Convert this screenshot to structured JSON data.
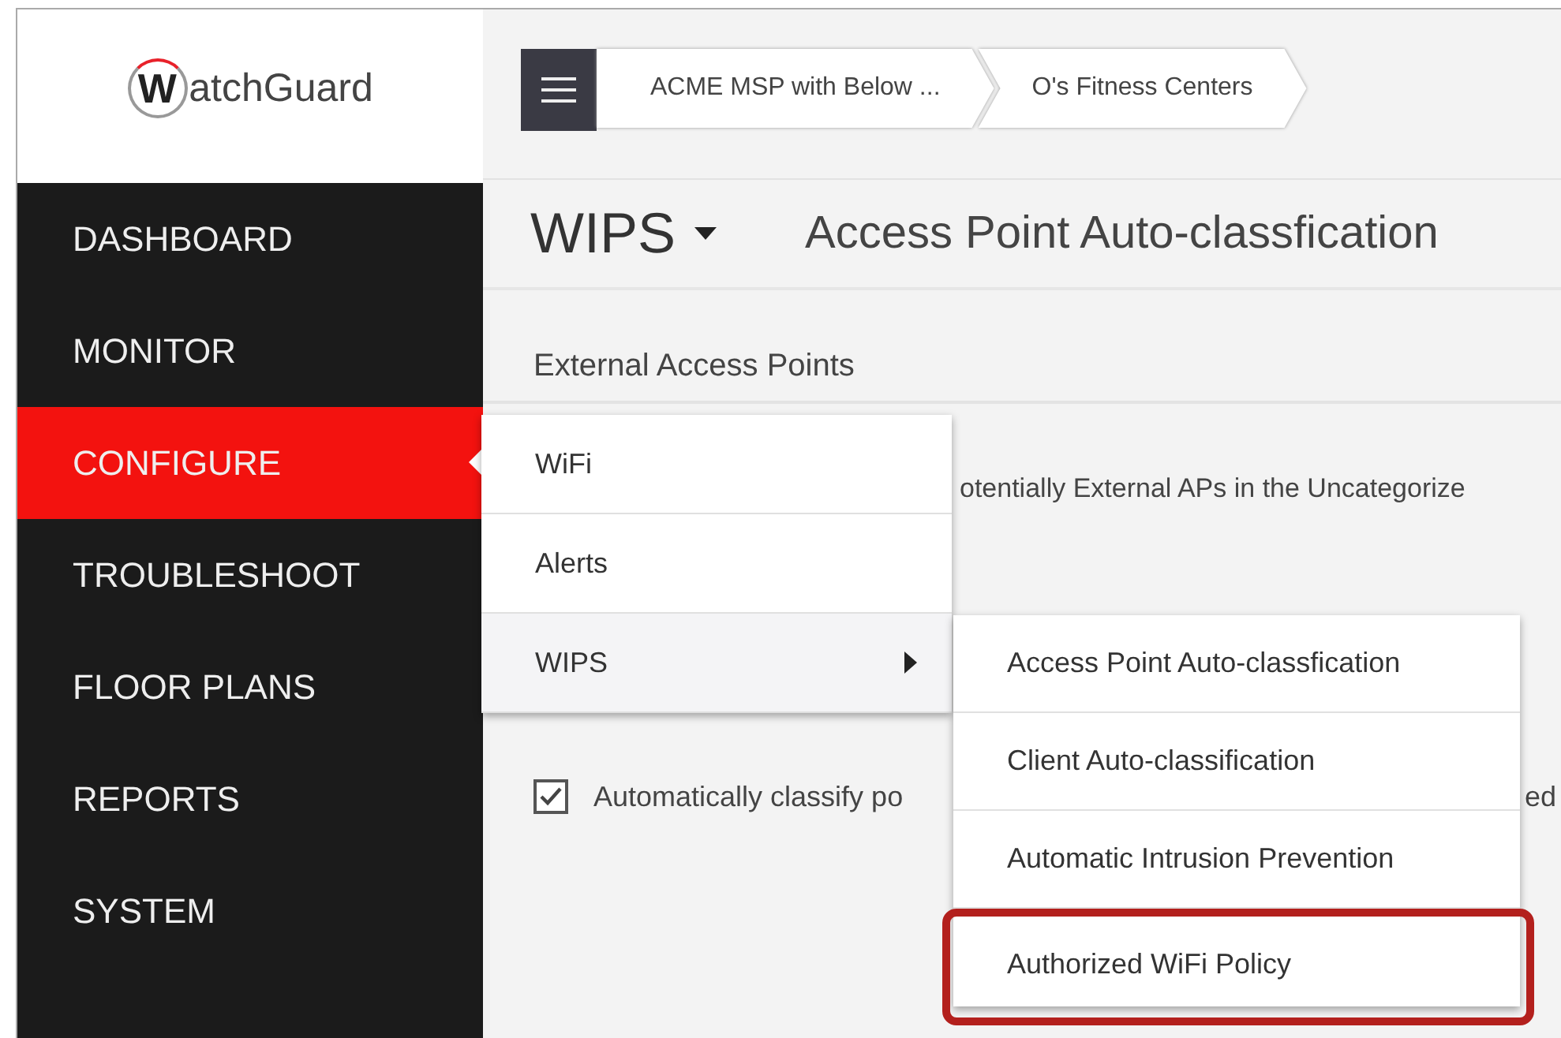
{
  "logo": {
    "initial": "W",
    "rest": "atchGuard"
  },
  "nav": [
    {
      "label": "DASHBOARD",
      "selected": false
    },
    {
      "label": "MONITOR",
      "selected": false
    },
    {
      "label": "CONFIGURE",
      "selected": true
    },
    {
      "label": "TROUBLESHOOT",
      "selected": false
    },
    {
      "label": "FLOOR PLANS",
      "selected": false
    },
    {
      "label": "REPORTS",
      "selected": false
    },
    {
      "label": "SYSTEM",
      "selected": false
    }
  ],
  "breadcrumbs": [
    "ACME MSP with Below ...",
    "O's Fitness Centers"
  ],
  "page_title": "WIPS",
  "page_subtitle": "Access Point Auto-classfication",
  "section_title": "External Access Points",
  "description_fragment": "otentially External APs in the Uncategorize",
  "auto_classify": {
    "checked": true,
    "label_fragment": "Automatically classify po",
    "trailing_fragment": "ed"
  },
  "flyout_menu": [
    {
      "label": "WiFi",
      "selected": false,
      "has_submenu": false
    },
    {
      "label": "Alerts",
      "selected": false,
      "has_submenu": false
    },
    {
      "label": "WIPS",
      "selected": true,
      "has_submenu": true
    }
  ],
  "submenu": [
    {
      "label": "Access Point Auto-classfication",
      "highlighted": false
    },
    {
      "label": "Client Auto-classification",
      "highlighted": false
    },
    {
      "label": "Automatic Intrusion Prevention",
      "highlighted": false
    },
    {
      "label": "Authorized WiFi Policy",
      "highlighted": true
    }
  ]
}
